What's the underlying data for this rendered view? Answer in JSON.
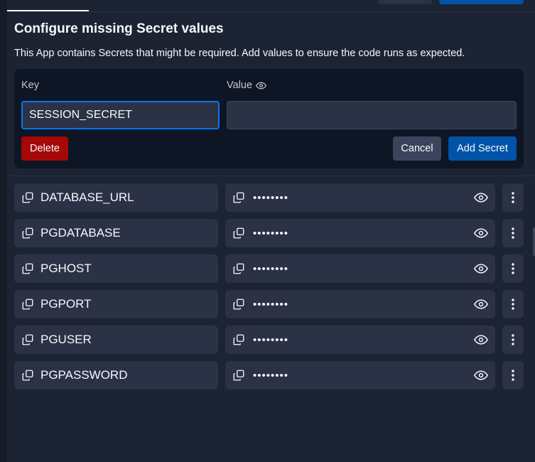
{
  "heading": "Configure missing Secret values",
  "subtext": "This App contains Secrets that might be required. Add values to ensure the code runs as expected.",
  "form": {
    "key_label": "Key",
    "value_label": "Value",
    "key_value": "SESSION_SECRET",
    "value_value": "",
    "delete_label": "Delete",
    "cancel_label": "Cancel",
    "add_label": "Add Secret"
  },
  "secrets": [
    {
      "key": "DATABASE_URL",
      "masked": "••••••••"
    },
    {
      "key": "PGDATABASE",
      "masked": "••••••••"
    },
    {
      "key": "PGHOST",
      "masked": "••••••••"
    },
    {
      "key": "PGPORT",
      "masked": "••••••••"
    },
    {
      "key": "PGUSER",
      "masked": "••••••••"
    },
    {
      "key": "PGPASSWORD",
      "masked": "••••••••"
    }
  ],
  "colors": {
    "background": "#1c2333",
    "card": "#0e1525",
    "surface": "#2b3245",
    "primary": "#0053a6",
    "danger": "#a60808",
    "focus": "#0079f2"
  }
}
